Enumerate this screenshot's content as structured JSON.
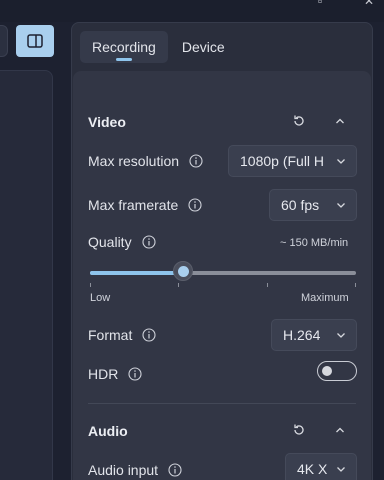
{
  "tabs": [
    {
      "label": "Recording",
      "active": true
    },
    {
      "label": "Device",
      "active": false
    }
  ],
  "video": {
    "title": "Video",
    "reset_icon": "reset-icon",
    "collapse_icon": "chevron-up-icon",
    "max_resolution": {
      "label": "Max resolution",
      "value": "1080p (Full H"
    },
    "max_framerate": {
      "label": "Max framerate",
      "value": "60 fps"
    },
    "quality": {
      "label": "Quality",
      "estimate": "~ 150 MB/min",
      "min_label": "Low",
      "max_label": "Maximum",
      "level_fraction": 0.35
    },
    "format": {
      "label": "Format",
      "value": "H.264"
    },
    "hdr": {
      "label": "HDR",
      "enabled": false
    }
  },
  "audio": {
    "title": "Audio",
    "reset_icon": "reset-icon",
    "collapse_icon": "chevron-up-icon",
    "audio_input": {
      "label": "Audio input",
      "value": "4K X"
    }
  },
  "colors": {
    "accent": "#8ec4ec",
    "panel_bg": "#2a2e3c",
    "section_bg": "#323645"
  }
}
